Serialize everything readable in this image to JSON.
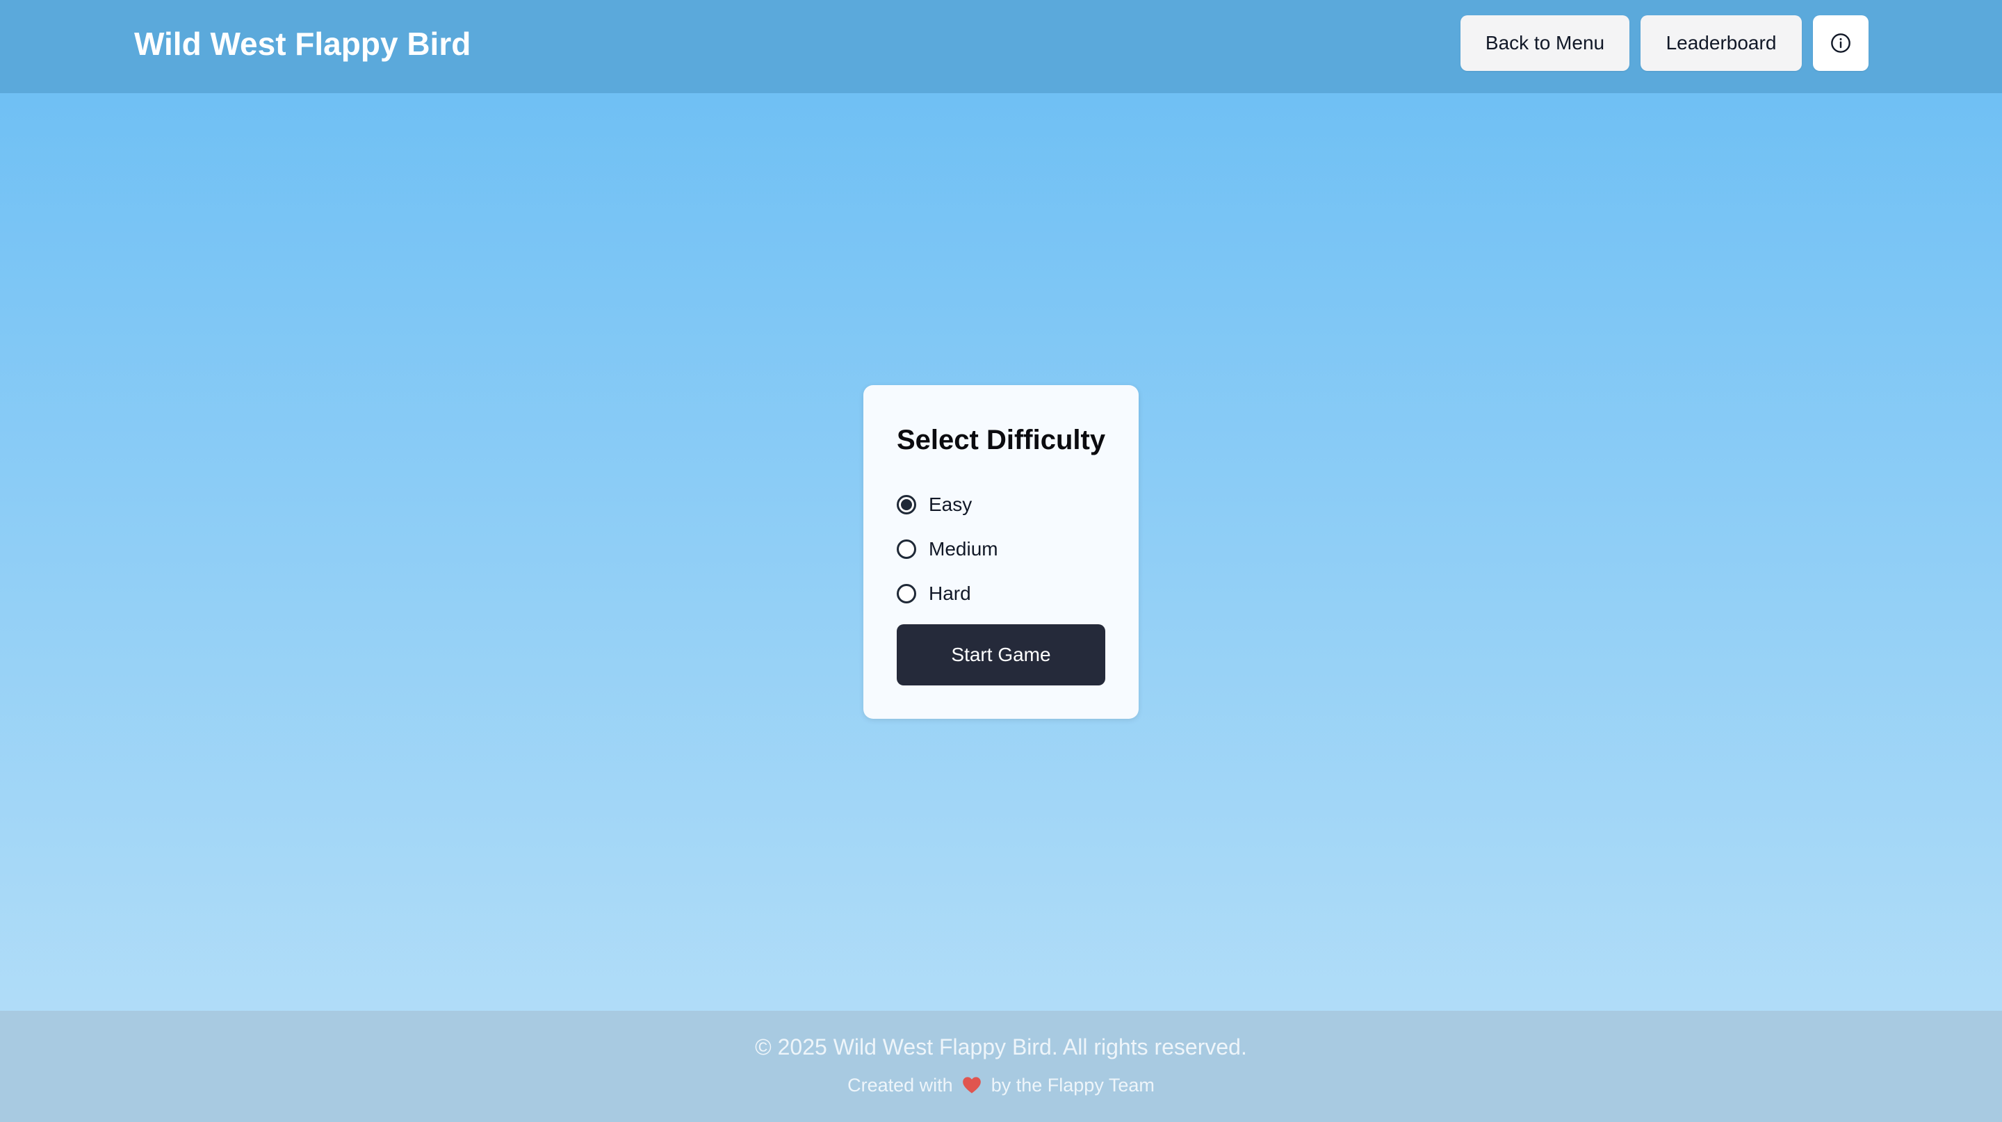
{
  "header": {
    "title": "Wild West Flappy Bird",
    "back_label": "Back to Menu",
    "leaderboard_label": "Leaderboard",
    "info_icon": "info-icon"
  },
  "difficulty": {
    "title": "Select Difficulty",
    "selected": "Easy",
    "options": [
      {
        "label": "Easy",
        "checked": true
      },
      {
        "label": "Medium",
        "checked": false
      },
      {
        "label": "Hard",
        "checked": false
      }
    ],
    "start_label": "Start Game"
  },
  "footer": {
    "copyright": "© 2025 Wild West Flappy Bird. All rights reserved.",
    "credit_before": "Created with",
    "credit_icon": "heart-icon",
    "credit_after": "by the Flappy Team"
  },
  "colors": {
    "header_bg": "#5ba9db",
    "sky_top": "#69bdf4",
    "sky_bottom": "#b8e0f8",
    "button_dark": "#252a3a",
    "footer_bg": "#a8cae1",
    "heart": "#e0554f"
  }
}
